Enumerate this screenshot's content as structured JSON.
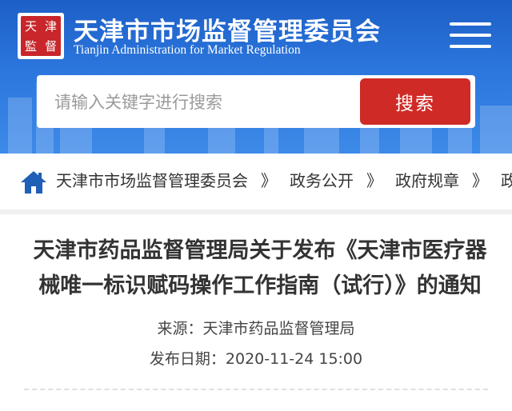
{
  "header": {
    "logo_chars": [
      "天",
      "津",
      "監",
      "督"
    ],
    "title": "天津市市场监督管理委员会",
    "subtitle": "Tianjin Administration for Market Regulation",
    "menu_icon": "hamburger-menu-icon"
  },
  "search": {
    "placeholder": "请输入关键字进行搜索",
    "button_label": "搜索"
  },
  "breadcrumb": {
    "items": [
      "天津市市场监督管理委员会",
      "政务公开",
      "政府规章",
      "政"
    ],
    "separator": "》"
  },
  "article": {
    "title": "天津市药品监督管理局关于发布《天津市医疗器械唯一标识赋码操作工作指南（试行）》的通知",
    "source_label": "来源：",
    "source": "天津市药品监督管理局",
    "date_label": "发布日期：",
    "date": "2020-11-24 15:00"
  },
  "colors": {
    "header_blue": "#2b76dd",
    "search_button_red": "#cf2a26"
  }
}
